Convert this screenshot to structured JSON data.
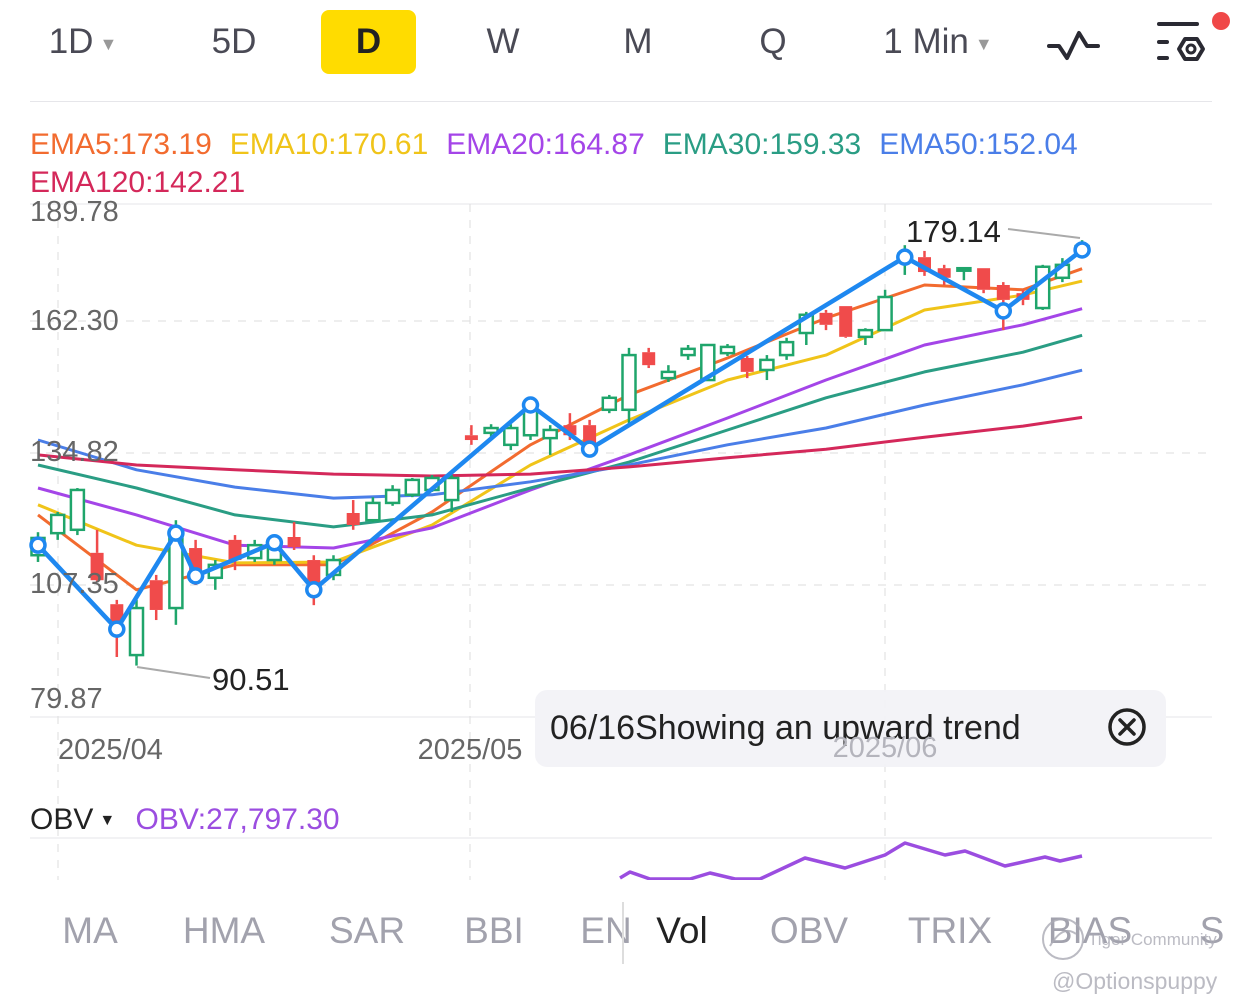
{
  "toolbar": {
    "tabs": [
      {
        "label": "1D",
        "dropdown": true
      },
      {
        "label": "5D"
      },
      {
        "label": "D",
        "selected": true
      },
      {
        "label": "W"
      },
      {
        "label": "M"
      },
      {
        "label": "Q"
      },
      {
        "label": "1 Min",
        "dropdown": true
      }
    ],
    "icons": [
      "pulse-wave-icon",
      "indicator-settings-icon"
    ],
    "notification_dot_color": "#f04848",
    "selected_color": "#ffdc00"
  },
  "legend": {
    "ema5": "EMA5:173.19",
    "ema10": "EMA10:170.61",
    "ema20": "EMA20:164.87",
    "ema30": "EMA30:159.33",
    "ema50": "EMA50:152.04",
    "ema120": "EMA120:142.21"
  },
  "tooltip": {
    "text": "06/16Showing an upward trend",
    "close_icon": "close-circle-icon"
  },
  "obv": {
    "selector_label": "OBV",
    "value_label": "OBV:27,797.30",
    "color": "#9b4de0"
  },
  "indicator_bar": {
    "items": [
      "MA",
      "HMA",
      "SAR",
      "BBI",
      "EN",
      "Vol",
      "OBV",
      "TRIX",
      "BIAS",
      "S"
    ],
    "selected": "Vol"
  },
  "watermark": {
    "brand": "Tiger Community",
    "handle": "@Optionspuppy"
  },
  "chart_data": {
    "type": "candlestick",
    "y_tick_labels": [
      "189.78",
      "162.30",
      "134.82",
      "107.35",
      "79.87"
    ],
    "y_ticks": [
      189.78,
      162.3,
      134.82,
      107.35,
      79.87
    ],
    "ylim": [
      79.87,
      189.78
    ],
    "x_tick_labels": [
      "2025/04",
      "2025/05",
      "2025/06"
    ],
    "x_tick_candle_index": [
      1,
      22,
      43
    ],
    "grid": true,
    "colors": {
      "up": "#1fa56b",
      "down": "#f04b4b",
      "ema5": "#f26b2f",
      "ema10": "#f0c419",
      "ema20": "#a445e8",
      "ema30": "#2a9d84",
      "ema50": "#4a7ee8",
      "ema120": "#d4285a",
      "trend": "#1e88f0"
    },
    "ohlc": [
      [
        113.5,
        118.3,
        112.1,
        117.1
      ],
      [
        118.1,
        122.5,
        116.7,
        121.9
      ],
      [
        118.8,
        127.5,
        117.7,
        127.1
      ],
      [
        114.0,
        118.8,
        107.9,
        108.3
      ],
      [
        103.3,
        104.2,
        92.3,
        99.6
      ],
      [
        92.7,
        104.2,
        90.51,
        102.5
      ],
      [
        108.3,
        109.4,
        100.0,
        102.1
      ],
      [
        102.5,
        120.8,
        99.0,
        118.1
      ],
      [
        115.0,
        116.7,
        107.3,
        109.4
      ],
      [
        108.8,
        112.5,
        106.3,
        111.5
      ],
      [
        116.7,
        117.7,
        110.4,
        112.5
      ],
      [
        112.9,
        116.7,
        112.1,
        115.6
      ],
      [
        112.5,
        117.7,
        111.5,
        116.7
      ],
      [
        117.3,
        120.4,
        114.6,
        115.2
      ],
      [
        112.5,
        113.5,
        103.1,
        107.7
      ],
      [
        109.4,
        113.5,
        108.3,
        112.5
      ],
      [
        122.3,
        125.0,
        118.8,
        119.8
      ],
      [
        120.8,
        125.6,
        120.4,
        124.4
      ],
      [
        124.4,
        128.1,
        123.8,
        127.1
      ],
      [
        126.1,
        129.6,
        125.6,
        129.2
      ],
      [
        127.1,
        130.2,
        126.7,
        129.6
      ],
      [
        125.0,
        130.2,
        122.5,
        129.6
      ],
      [
        138.5,
        140.6,
        136.5,
        137.5
      ],
      [
        139.0,
        140.8,
        137.5,
        140.0
      ],
      [
        136.5,
        140.8,
        135.4,
        140.0
      ],
      [
        138.5,
        145.8,
        137.5,
        144.8
      ],
      [
        137.9,
        140.6,
        134.4,
        139.6
      ],
      [
        140.6,
        143.1,
        137.5,
        138.5
      ],
      [
        140.6,
        141.7,
        135.4,
        136.5
      ],
      [
        143.8,
        146.9,
        143.1,
        146.3
      ],
      [
        143.8,
        156.7,
        140.6,
        155.2
      ],
      [
        155.8,
        156.7,
        152.5,
        153.1
      ],
      [
        150.4,
        153.1,
        149.6,
        151.7
      ],
      [
        155.2,
        157.3,
        154.2,
        156.5
      ],
      [
        150.0,
        157.5,
        150.0,
        157.3
      ],
      [
        155.6,
        157.5,
        155.0,
        156.9
      ],
      [
        154.6,
        155.0,
        150.4,
        151.7
      ],
      [
        152.1,
        155.2,
        150.0,
        154.2
      ],
      [
        155.2,
        158.8,
        154.2,
        157.9
      ],
      [
        159.8,
        164.2,
        157.3,
        163.6
      ],
      [
        164.0,
        164.6,
        160.4,
        161.5
      ],
      [
        165.4,
        165.4,
        158.8,
        159.0
      ],
      [
        159.0,
        160.8,
        157.3,
        160.4
      ],
      [
        160.4,
        168.8,
        160.4,
        167.3
      ],
      [
        175.4,
        178.1,
        171.9,
        176.3
      ],
      [
        175.6,
        176.9,
        171.7,
        172.5
      ],
      [
        173.3,
        174.0,
        169.8,
        171.3
      ],
      [
        172.9,
        173.3,
        170.8,
        173.3
      ],
      [
        173.3,
        173.3,
        168.1,
        168.8
      ],
      [
        169.8,
        170.4,
        160.4,
        166.7
      ],
      [
        168.1,
        168.8,
        165.6,
        166.7
      ],
      [
        165.0,
        174.0,
        164.6,
        173.6
      ],
      [
        171.3,
        175.4,
        170.4,
        174.0
      ],
      [
        176.7,
        179.14,
        176.7,
        177.9
      ]
    ],
    "ema_sample_index": [
      0,
      5,
      10,
      15,
      20,
      25,
      30,
      35,
      40,
      45,
      50,
      53
    ],
    "series": [
      {
        "name": "EMA5",
        "values": [
          121.9,
          106.3,
          111.5,
          111.5,
          122.5,
          136.5,
          146.9,
          154.6,
          162.9,
          169.8,
          168.8,
          173.19
        ]
      },
      {
        "name": "EMA10",
        "values": [
          124.0,
          115.6,
          111.9,
          112.1,
          119.8,
          132.3,
          141.7,
          150.0,
          155.2,
          164.6,
          167.7,
          170.61
        ]
      },
      {
        "name": "EMA20",
        "values": [
          127.5,
          121.9,
          115.6,
          115.0,
          119.2,
          127.1,
          134.4,
          142.1,
          150.0,
          157.3,
          161.5,
          164.87
        ]
      },
      {
        "name": "EMA30",
        "values": [
          132.3,
          127.5,
          121.9,
          119.4,
          121.9,
          127.5,
          132.9,
          139.6,
          146.3,
          151.7,
          155.8,
          159.33
        ]
      },
      {
        "name": "EMA50",
        "values": [
          137.5,
          131.3,
          127.7,
          125.4,
          126.1,
          128.8,
          132.3,
          136.5,
          140.0,
          144.8,
          149.0,
          152.04
        ]
      },
      {
        "name": "EMA120",
        "values": [
          134.4,
          132.3,
          131.3,
          130.4,
          130.0,
          130.4,
          131.9,
          133.8,
          135.6,
          138.1,
          140.4,
          142.21
        ]
      }
    ],
    "trend_line": {
      "index": [
        0,
        4,
        7,
        8,
        12,
        14,
        25,
        28,
        44,
        49,
        53
      ],
      "values": [
        115.6,
        98.1,
        118.1,
        109.2,
        116.1,
        106.3,
        144.8,
        135.6,
        175.6,
        164.4,
        177.1
      ]
    },
    "annotations": {
      "low_label": "90.51",
      "low_index": 5,
      "low_value": 90.51,
      "high_label": "179.14",
      "high_index": 53,
      "high_value": 179.14
    }
  }
}
